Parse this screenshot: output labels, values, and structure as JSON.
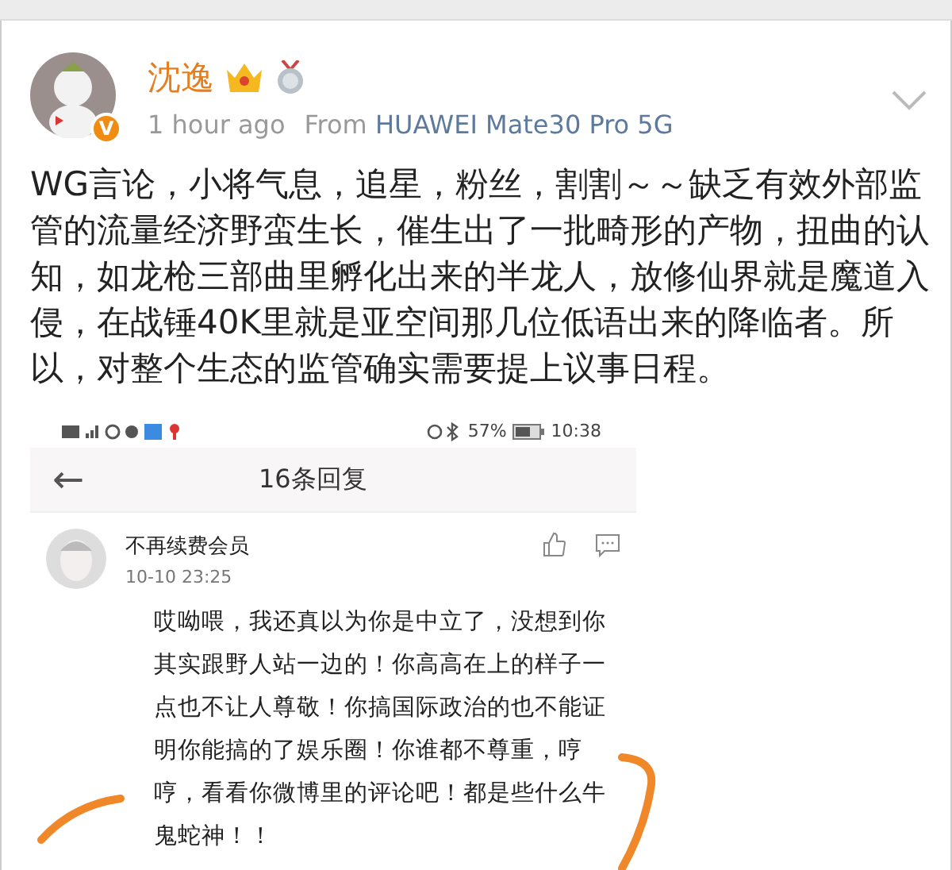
{
  "post": {
    "author": {
      "name": "沈逸",
      "verified_mark": "V"
    },
    "time": "1 hour ago",
    "source_prefix": "From",
    "source": "HUAWEI Mate30 Pro 5G",
    "text": "WG言论，小将气息，追星，粉丝，割割～～缺乏有效外部监管的流量经济野蛮生长，催生出了一批畸形的产物，扭曲的认知，如龙枪三部曲里孵化出来的半龙人，放修仙界就是魔道入侵，在战锤40K里就是亚空间那几位低语出来的降临者。所以，对整个生态的监管确实需要提上议事日程。"
  },
  "embedded_screenshot": {
    "status_bar": {
      "battery": "57%",
      "time": "10:38"
    },
    "header": {
      "back": "←",
      "title": "16条回复"
    },
    "comment": {
      "user": "不再续费会员",
      "time": "10-10 23:25",
      "text": "哎呦喂，我还真以为你是中立了，没想到你其实跟野人站一边的！你高高在上的样子一点也不让人尊敬！你搞国际政治的也不能证明你能搞的了娱乐圈！你谁都不尊重，哼哼，看看你微博里的评论吧！都是些什么牛鬼蛇神！！"
    }
  }
}
